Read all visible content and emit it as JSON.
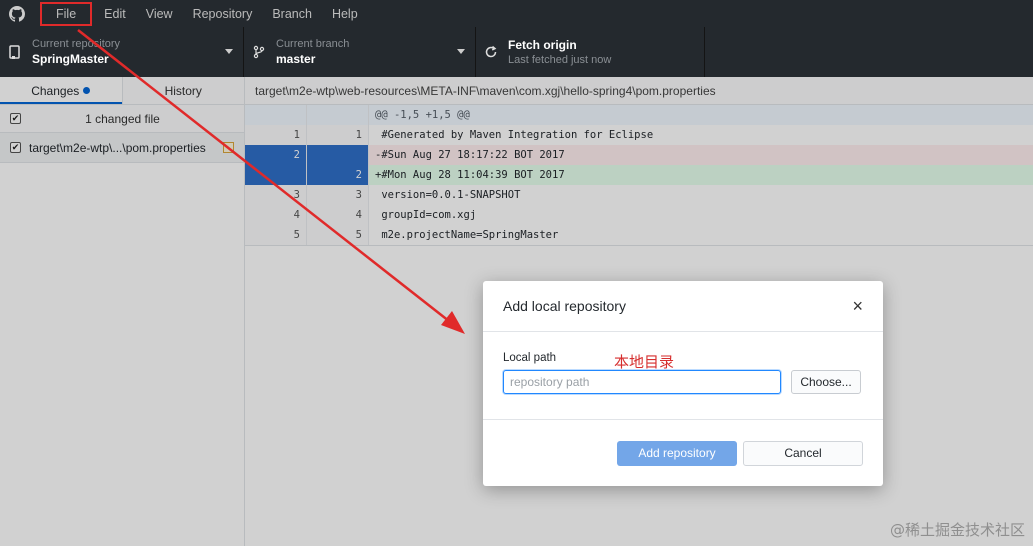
{
  "menu": {
    "items": [
      "File",
      "Edit",
      "View",
      "Repository",
      "Branch",
      "Help"
    ]
  },
  "toolbar": {
    "repo_label": "Current repository",
    "repo_value": "SpringMaster",
    "branch_label": "Current branch",
    "branch_value": "master",
    "fetch_title": "Fetch origin",
    "fetch_sub": "Last fetched just now"
  },
  "sidebar": {
    "tab_changes": "Changes",
    "tab_history": "History",
    "summary": "1 changed file",
    "file_path": "target\\m2e-wtp\\...\\pom.properties"
  },
  "main": {
    "path": "target\\m2e-wtp\\web-resources\\META-INF\\maven\\com.xgj\\hello-spring4\\pom.properties",
    "diff": [
      {
        "type": "hunk",
        "old": "",
        "new": "",
        "text": "@@ -1,5 +1,5 @@"
      },
      {
        "type": "ctx",
        "old": "1",
        "new": "1",
        "text": " #Generated by Maven Integration for Eclipse"
      },
      {
        "type": "del",
        "old": "2",
        "new": "",
        "text": "-#Sun Aug 27 18:17:22 BOT 2017"
      },
      {
        "type": "add",
        "old": "",
        "new": "2",
        "text": "+#Mon Aug 28 11:04:39 BOT 2017"
      },
      {
        "type": "ctx",
        "old": "3",
        "new": "3",
        "text": " version=0.0.1-SNAPSHOT"
      },
      {
        "type": "ctx",
        "old": "4",
        "new": "4",
        "text": " groupId=com.xgj"
      },
      {
        "type": "ctx",
        "old": "5",
        "new": "5",
        "text": " m2e.projectName=SpringMaster"
      }
    ]
  },
  "dialog": {
    "title": "Add local repository",
    "close_glyph": "×",
    "field_label": "Local path",
    "annotation": "本地目录",
    "input_value": "",
    "input_placeholder": "repository path",
    "choose_label": "Choose...",
    "add_label": "Add repository",
    "cancel_label": "Cancel"
  },
  "watermark": "@稀土掘金技术社区",
  "colors": {
    "accent": "#0366d6",
    "annotation_red": "#e02a2a",
    "toolbar_bg": "#24292e"
  }
}
